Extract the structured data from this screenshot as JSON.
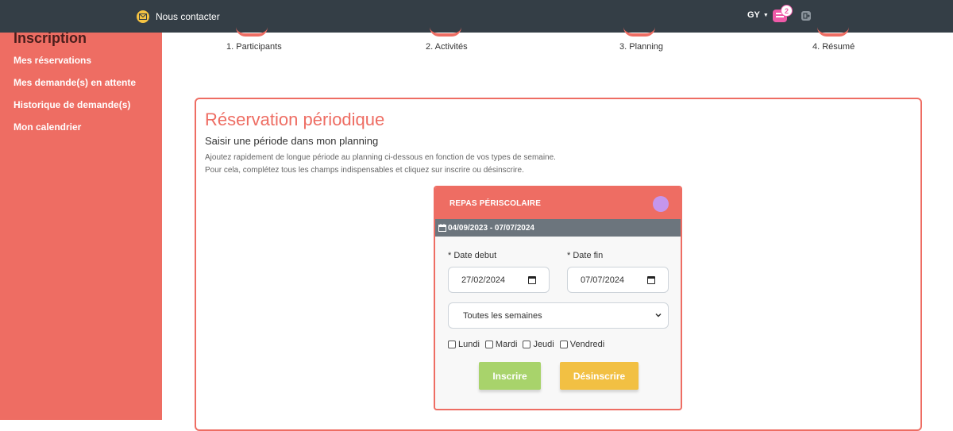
{
  "topbar": {
    "contact_label": "Nous contacter",
    "user_initials": "GY",
    "cart_count": "2",
    "colors": {
      "bg": "#343e46",
      "cart": "#ef5aa8",
      "contact_icon": "#f5c342"
    },
    "icons": {
      "contact": "envelope-icon",
      "cart": "cart-icon",
      "logout": "logout-icon"
    }
  },
  "sidebar": {
    "title": "Inscription",
    "items": [
      {
        "label": "Mes réservations"
      },
      {
        "label": "Mes demande(s) en attente"
      },
      {
        "label": "Historique de demande(s)"
      },
      {
        "label": "Mon calendrier"
      }
    ],
    "color": "#ee6d63"
  },
  "steps": [
    {
      "label": "1. Participants"
    },
    {
      "label": "2. Activités"
    },
    {
      "label": "3. Planning"
    },
    {
      "label": "4. Résumé"
    }
  ],
  "main": {
    "title": "Réservation périodique",
    "subtitle": "Saisir une période dans mon planning",
    "desc1": "Ajoutez rapidement de longue période au planning ci-dessous en fonction de vos types de semaine.",
    "desc2": "Pour cela, complétez tous les champs indispensables et cliquez sur inscrire ou désinscrire."
  },
  "activity": {
    "name": "REPAS PÉRISCOLAIRE",
    "period": "04/09/2023 - 07/07/2024",
    "color_dot": "#c596ec",
    "date_debut_label": "* Date debut",
    "date_debut_value": "27/02/2024",
    "date_fin_label": "* Date fin",
    "date_fin_value": "07/07/2024",
    "week_type_selected": "Toutes les semaines",
    "days": [
      {
        "label": "Lundi"
      },
      {
        "label": "Mardi"
      },
      {
        "label": "Jeudi"
      },
      {
        "label": "Vendredi"
      }
    ],
    "btn_inscrire": "Inscrire",
    "btn_desinscrire": "Désinscrire"
  }
}
